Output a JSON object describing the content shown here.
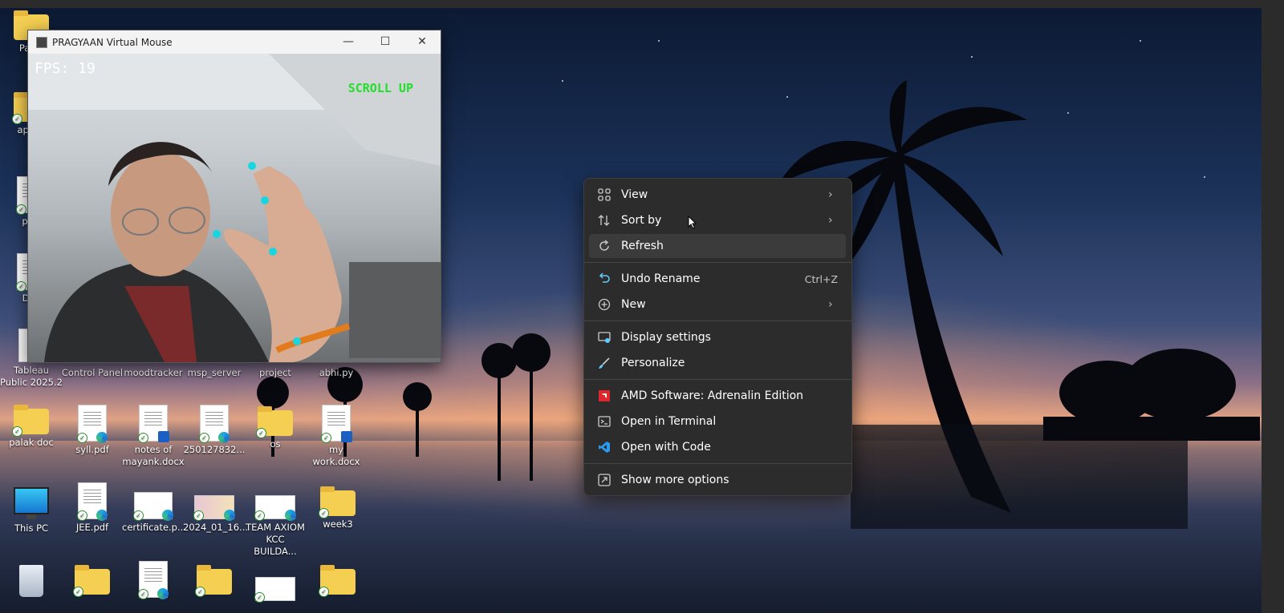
{
  "camera_window": {
    "title": "PRAGYAAN Virtual Mouse",
    "fps": "FPS: 19",
    "gesture": "SCROLL UP"
  },
  "desktop_icons": [
    {
      "label": "Palak",
      "kind": "folder"
    },
    {
      "label": "apach",
      "kind": "folder"
    },
    {
      "label": "prot",
      "kind": "file"
    },
    {
      "label": "DAY",
      "kind": "file"
    },
    {
      "label": "Tableau Public 2025.2",
      "kind": "app"
    },
    {
      "label": "Control Panel",
      "kind": "app"
    },
    {
      "label": "moodtracker",
      "kind": "folder"
    },
    {
      "label": "msp_server",
      "kind": "folder"
    },
    {
      "label": "project",
      "kind": "folder"
    },
    {
      "label": "abhi.py",
      "kind": "file"
    },
    {
      "label": "palak doc",
      "kind": "folder"
    },
    {
      "label": "syll.pdf",
      "kind": "pdf"
    },
    {
      "label": "notes of mayank.docx",
      "kind": "docx"
    },
    {
      "label": "250127832...",
      "kind": "pdf"
    },
    {
      "label": "os",
      "kind": "folder"
    },
    {
      "label": "my work.docx",
      "kind": "docx"
    },
    {
      "label": "This PC",
      "kind": "pc"
    },
    {
      "label": "JEE.pdf",
      "kind": "pdf"
    },
    {
      "label": "certificate.p...",
      "kind": "pdf"
    },
    {
      "label": "2024_01_16...",
      "kind": "pdf"
    },
    {
      "label": "TEAM AXIOM KCC BUILDA...",
      "kind": "pdf"
    },
    {
      "label": "week3",
      "kind": "folder"
    }
  ],
  "context_menu": {
    "items": [
      {
        "label": "View",
        "icon": "grid-icon",
        "submenu": true
      },
      {
        "label": "Sort by",
        "icon": "sort-icon",
        "submenu": true
      },
      {
        "label": "Refresh",
        "icon": "refresh-icon",
        "submenu": false
      },
      {
        "label": "Undo Rename",
        "icon": "undo-icon",
        "shortcut": "Ctrl+Z"
      },
      {
        "label": "New",
        "icon": "plus-circle-icon",
        "submenu": true
      },
      {
        "label": "Display settings",
        "icon": "display-icon"
      },
      {
        "label": "Personalize",
        "icon": "brush-icon"
      },
      {
        "label": "AMD Software: Adrenalin Edition",
        "icon": "amd-icon"
      },
      {
        "label": "Open in Terminal",
        "icon": "terminal-icon"
      },
      {
        "label": "Open with Code",
        "icon": "vscode-icon"
      },
      {
        "label": "Show more options",
        "icon": "more-options-icon"
      }
    ],
    "highlighted": "Refresh",
    "colors": {
      "amd": "#e0262a",
      "vscode": "#2a9bf0",
      "accent": "#60cdff"
    }
  }
}
